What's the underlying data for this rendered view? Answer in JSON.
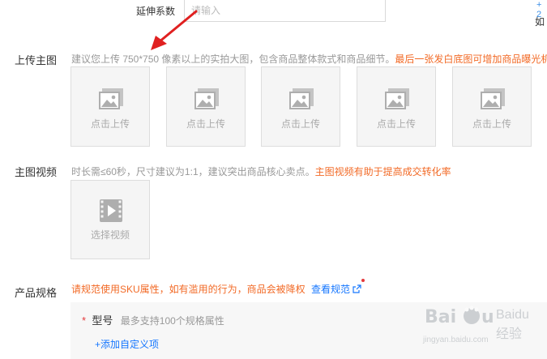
{
  "top_row": {
    "label": "延伸系数",
    "input_placeholder": "请输入",
    "right_cut_a": "+ 2",
    "right_cut_b": "如"
  },
  "main_image": {
    "label": "上传主图",
    "hint": "建议您上传 750*750 像素以上的实拍大图，包含商品整体款式和商品细节。",
    "hint_warn": "最后一张发白底图可增加商品曝光机",
    "slots": [
      {
        "label": "点击上传"
      },
      {
        "label": "点击上传"
      },
      {
        "label": "点击上传"
      },
      {
        "label": "点击上传"
      },
      {
        "label": "点击上传"
      }
    ]
  },
  "main_video": {
    "label": "主图视频",
    "hint": "时长需≤60秒，尺寸建议为1:1，建议突出商品核心卖点。",
    "hint_warn": "主图视频有助于提高成交转化率",
    "button_label": "选择视频"
  },
  "product_spec": {
    "label": "产品规格",
    "warning": "请规范使用SKU属性，如有滥用的行为，商品会被降权",
    "link": "查看规范",
    "model_label": "型号",
    "model_hint": "最多支持100个规格属性",
    "add_custom": "+添加自定义项"
  },
  "watermark": {
    "line1": "Baidu 经验",
    "line2": "jingyan.baidu.com"
  },
  "colors": {
    "warn": "#f26a26",
    "link": "#1677ff",
    "annotation_arrow": "#e02020",
    "required": "#e4393c"
  },
  "icons": [
    "image-placeholder-icon",
    "video-play-icon",
    "external-link-icon",
    "annotation-arrow"
  ]
}
